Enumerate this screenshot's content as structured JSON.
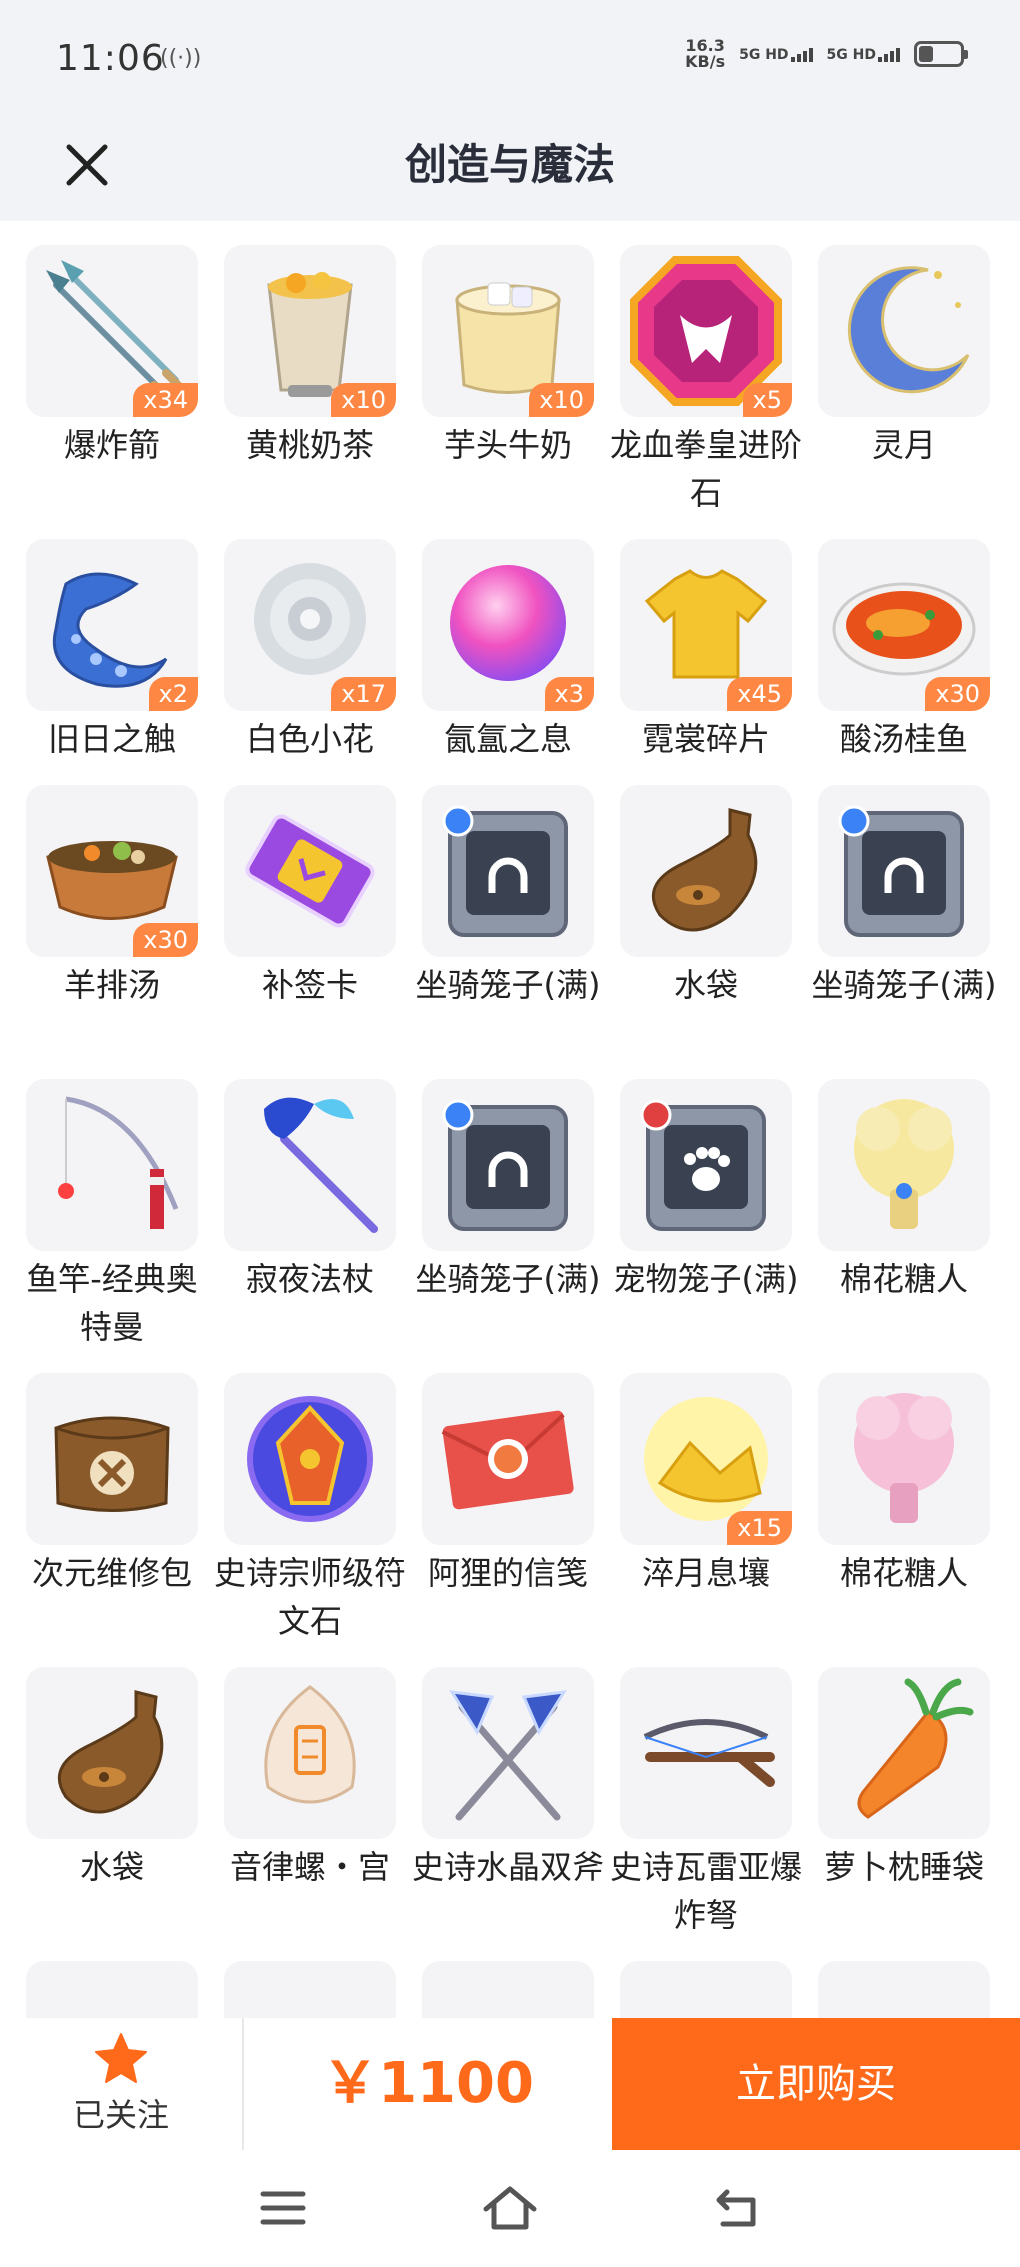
{
  "status": {
    "time": "11:06",
    "speed_value": "16.3",
    "speed_unit": "KB/s",
    "sim1": "5G HD",
    "sim2": "5G HD"
  },
  "header": {
    "title": "创造与魔法"
  },
  "items": [
    {
      "name": "爆炸箭",
      "count": "x34",
      "icon": "arrows-icon"
    },
    {
      "name": "黄桃奶茶",
      "count": "x10",
      "icon": "peach-milk-tea-icon"
    },
    {
      "name": "芋头牛奶",
      "count": "x10",
      "icon": "taro-milk-icon"
    },
    {
      "name": "龙血拳皇进阶石",
      "count": "x5",
      "icon": "dragon-gem-icon"
    },
    {
      "name": "灵月",
      "count": "",
      "icon": "crescent-moon-icon"
    },
    {
      "name": "旧日之触",
      "count": "x2",
      "icon": "tentacle-icon"
    },
    {
      "name": "白色小花",
      "count": "x17",
      "icon": "white-flower-icon"
    },
    {
      "name": "氤氲之息",
      "count": "x3",
      "icon": "pink-orb-icon"
    },
    {
      "name": "霓裳碎片",
      "count": "x45",
      "icon": "shirt-icon"
    },
    {
      "name": "酸汤桂鱼",
      "count": "x30",
      "icon": "fish-soup-icon"
    },
    {
      "name": "羊排汤",
      "count": "x30",
      "icon": "lamb-soup-icon"
    },
    {
      "name": "补签卡",
      "count": "",
      "icon": "sign-card-icon"
    },
    {
      "name": "坐骑笼子(满)",
      "count": "",
      "icon": "mount-cage-icon"
    },
    {
      "name": "水袋",
      "count": "",
      "icon": "water-bag-icon"
    },
    {
      "name": "坐骑笼子(满)",
      "count": "",
      "icon": "mount-cage-icon"
    },
    {
      "name": "鱼竿-经典奥特曼",
      "count": "",
      "icon": "fishing-rod-icon"
    },
    {
      "name": "寂夜法杖",
      "count": "",
      "icon": "staff-icon"
    },
    {
      "name": "坐骑笼子(满)",
      "count": "",
      "icon": "mount-cage-icon"
    },
    {
      "name": "宠物笼子(满)",
      "count": "",
      "icon": "pet-cage-icon"
    },
    {
      "name": "棉花糖人",
      "count": "",
      "icon": "yellow-cotton-creature-icon"
    },
    {
      "name": "次元维修包",
      "count": "",
      "icon": "repair-bag-icon"
    },
    {
      "name": "史诗宗师级符文石",
      "count": "",
      "icon": "rune-stone-icon"
    },
    {
      "name": "阿狸的信笺",
      "count": "",
      "icon": "letter-icon"
    },
    {
      "name": "淬月息壤",
      "count": "x15",
      "icon": "gold-soil-icon"
    },
    {
      "name": "棉花糖人",
      "count": "",
      "icon": "pink-cotton-creature-icon"
    },
    {
      "name": "水袋",
      "count": "",
      "icon": "water-bag-icon"
    },
    {
      "name": "音律螺・宫",
      "count": "",
      "icon": "conch-icon"
    },
    {
      "name": "史诗水晶双斧",
      "count": "",
      "icon": "double-axe-icon"
    },
    {
      "name": "史诗瓦雷亚爆炸弩",
      "count": "",
      "icon": "crossbow-icon"
    },
    {
      "name": "萝卜枕睡袋",
      "count": "",
      "icon": "carrot-pillow-icon"
    }
  ],
  "colors": {
    "accent": "#ff6a1a",
    "badge": "#ff8744",
    "star": "#ff6a1a",
    "header_bg": "#f1f3f6"
  },
  "bottom": {
    "follow_label": "已关注",
    "price": "￥1100",
    "buy_label": "立即购买"
  },
  "nav": {
    "menu": "menu-icon",
    "home": "home-icon",
    "back": "back-icon"
  }
}
